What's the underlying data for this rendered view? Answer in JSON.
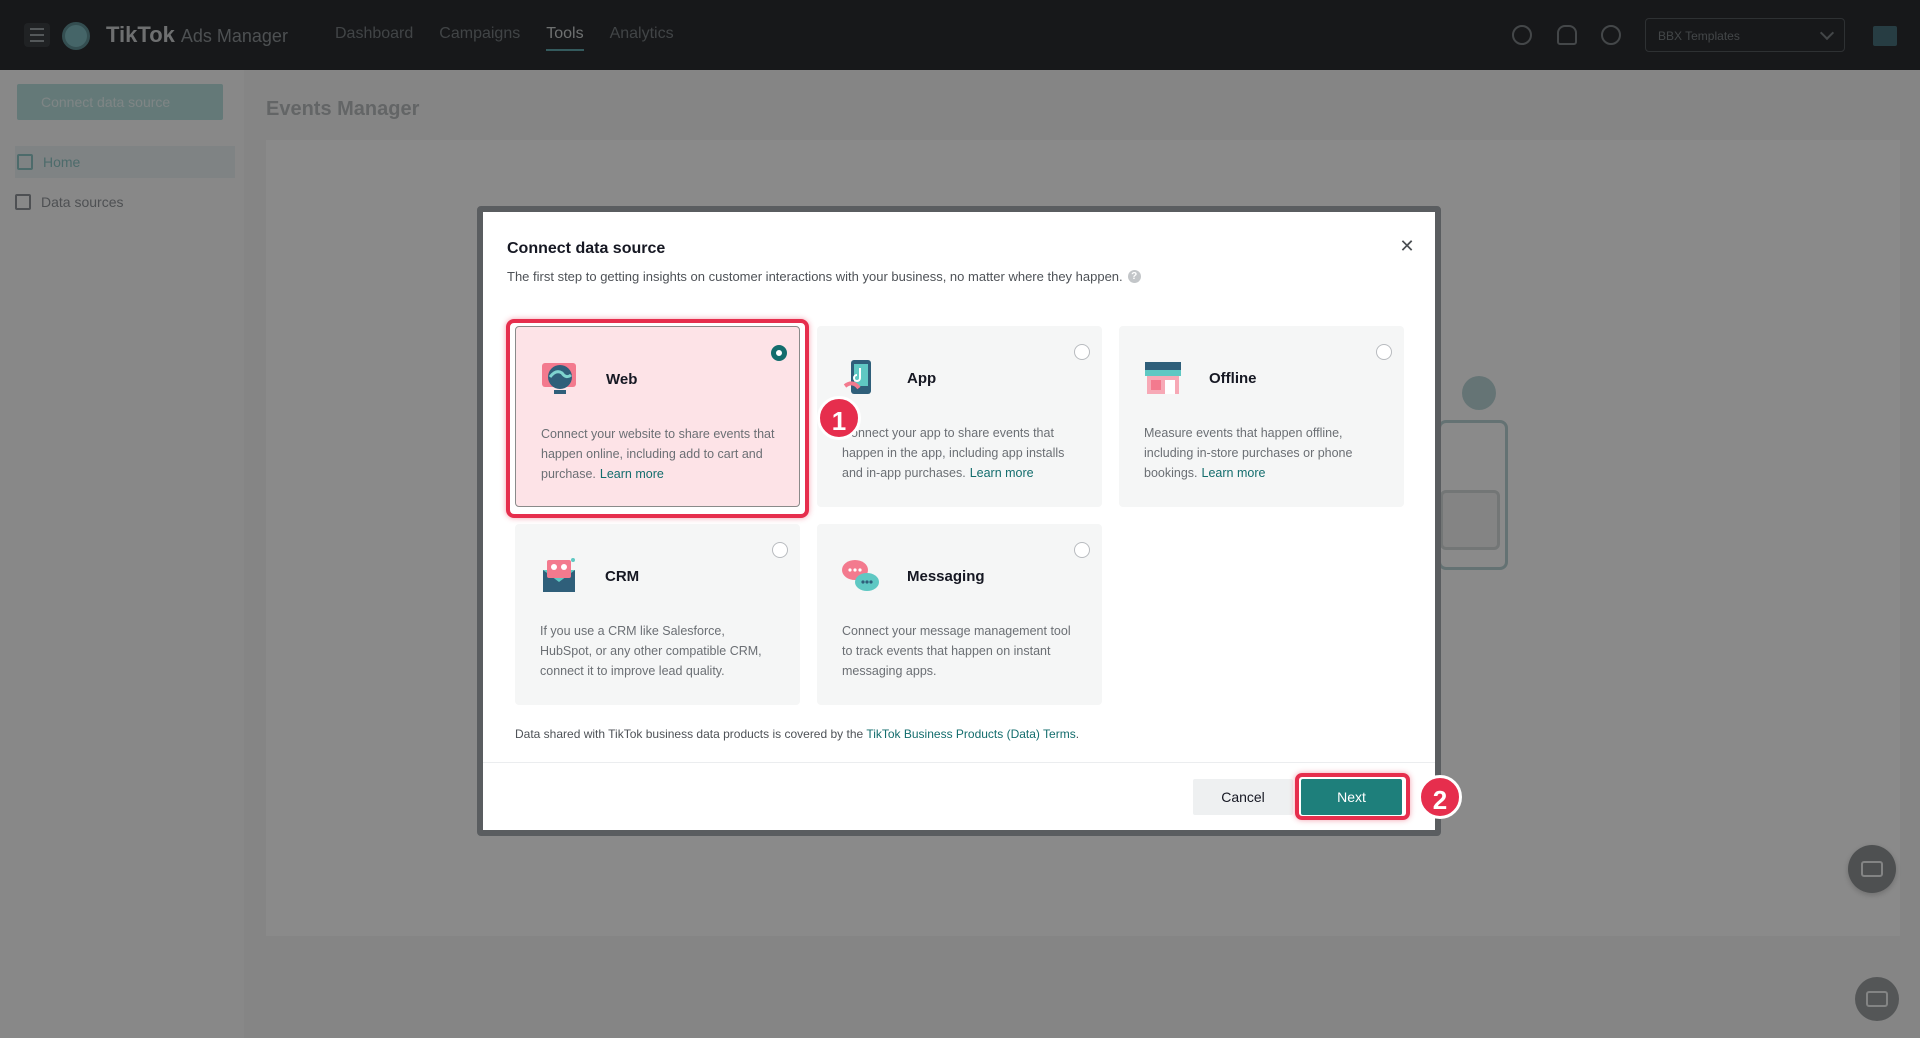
{
  "app": {
    "brand": "TikTok",
    "brand_sub": "Ads Manager",
    "nav": [
      "Dashboard",
      "Campaigns",
      "Tools",
      "Analytics"
    ],
    "nav_active": "Tools",
    "account_select": "BBX Templates"
  },
  "sidebar": {
    "connect_button": "Connect data source",
    "items": [
      {
        "label": "Home",
        "icon": "home-icon"
      },
      {
        "label": "Data sources",
        "icon": "list-icon"
      }
    ]
  },
  "page": {
    "title": "Events Manager"
  },
  "modal": {
    "title": "Connect data source",
    "subtitle": "The first step to getting insights on customer interactions with your business, no matter where they happen.",
    "help_glyph": "?",
    "close_glyph": "✕",
    "cards": [
      {
        "title": "Web",
        "desc": "Connect your website to share events that happen online, including add to cart and purchase.",
        "learn": "Learn more",
        "icon": "web-globe-icon"
      },
      {
        "title": "App",
        "desc": "Connect your app to share events that happen in the app, including app installs and in-app purchases.",
        "learn": "Learn more",
        "icon": "app-phone-icon"
      },
      {
        "title": "Offline",
        "desc": "Measure events that happen offline, including in-store purchases or phone bookings.",
        "learn": "Learn more",
        "icon": "store-icon"
      },
      {
        "title": "CRM",
        "desc": "If you use a CRM like Salesforce, HubSpot, or any other compatible CRM, connect it to improve lead quality.",
        "learn": "",
        "icon": "crm-icon"
      },
      {
        "title": "Messaging",
        "desc": "Connect your message management tool to track events that happen on instant messaging apps.",
        "learn": "",
        "icon": "messaging-icon"
      }
    ],
    "selected_card": "Web",
    "terms_prefix": "Data shared with TikTok business data products is covered by the",
    "terms_link": "TikTok Business Products (Data) Terms",
    "terms_suffix": ".",
    "cancel_label": "Cancel",
    "next_label": "Next"
  },
  "annotations": {
    "step1": "1",
    "step2": "2"
  },
  "colors": {
    "accent": "#136d6d",
    "highlight": "#e62e4d",
    "selected_bg": "#fde3e7"
  }
}
